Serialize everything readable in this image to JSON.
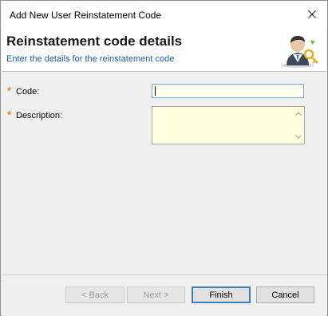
{
  "window": {
    "title": "Add New User Reinstatement Code",
    "close_glyph": "✕"
  },
  "header": {
    "title": "Reinstatement code details",
    "subtitle": "Enter the details for the reinstatement code",
    "graphic_icon": "user-key-icon"
  },
  "form": {
    "required_mark": "*",
    "code_label": "Code:",
    "code_value": "",
    "description_label": "Description:",
    "description_value": ""
  },
  "footer": {
    "back_label": "< Back",
    "next_label": "Next >",
    "finish_label": "Finish",
    "cancel_label": "Cancel"
  },
  "colors": {
    "required": "#e8841e",
    "subtitle": "#1e5aa8",
    "input_bg": "#ffffe0"
  }
}
